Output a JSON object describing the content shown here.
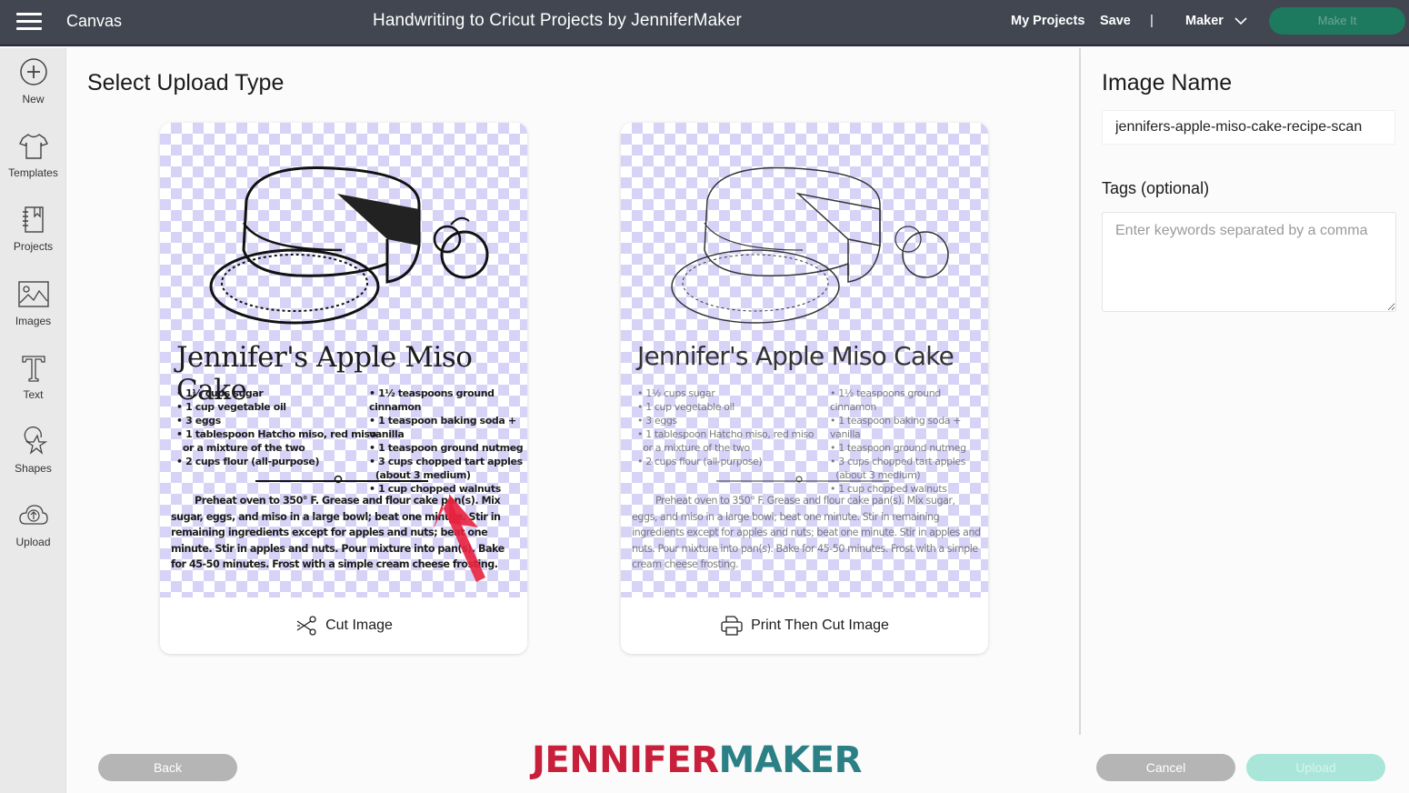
{
  "topbar": {
    "app_title": "Canvas",
    "document_title": "Handwriting to Cricut Projects by JenniferMaker",
    "my_projects": "My Projects",
    "save": "Save",
    "separator": "|",
    "machine": "Maker",
    "make_it": "Make It",
    "colors": {
      "background": "#414650",
      "make_it": "#1e7a5e"
    }
  },
  "sidebar": {
    "items": [
      {
        "label": "New",
        "icon": "plus-circle-icon"
      },
      {
        "label": "Templates",
        "icon": "tshirt-icon"
      },
      {
        "label": "Projects",
        "icon": "notebook-icon"
      },
      {
        "label": "Images",
        "icon": "image-icon"
      },
      {
        "label": "Text",
        "icon": "text-t-icon"
      },
      {
        "label": "Shapes",
        "icon": "shapes-icon"
      },
      {
        "label": "Upload",
        "icon": "cloud-upload-icon"
      }
    ]
  },
  "main": {
    "title": "Select Upload Type",
    "options": [
      {
        "label": "Cut Image",
        "icon": "scissors-icon"
      },
      {
        "label": "Print Then Cut Image",
        "icon": "printer-icon"
      }
    ],
    "recipe": {
      "title": "Jennifer's Apple Miso Cake",
      "ingredients_left": [
        "1½ cups sugar",
        "1 cup vegetable oil",
        "3 eggs",
        "1 tablespoon Hatcho miso, red miso",
        "or a mixture of the two",
        "2 cups flour (all-purpose)"
      ],
      "ingredients_right": [
        "1½ teaspoons ground cinnamon",
        "1 teaspoon baking soda + vanilla",
        "1 teaspoon ground nutmeg",
        "3 cups chopped tart apples",
        "(about 3 medium)",
        "1 cup chopped walnuts"
      ],
      "directions": "Preheat oven to 350° F. Grease and flour cake pan(s). Mix sugar, eggs, and miso in a large bowl; beat one minute. Stir in remaining ingredients except for apples and nuts; beat one minute. Stir in apples and nuts. Pour mixture into pan(s). Bake for 45-50 minutes. Frost with a simple cream cheese frosting."
    }
  },
  "right_panel": {
    "image_name_label": "Image Name",
    "image_name_value": "jennifers-apple-miso-cake-recipe-scan",
    "tags_label": "Tags (optional)",
    "tags_placeholder": "Enter keywords separated by a comma",
    "tags_value": ""
  },
  "footer": {
    "back": "Back",
    "cancel": "Cancel",
    "upload": "Upload",
    "logo_part1": "JENNIFER",
    "logo_part2": "MAKER",
    "colors": {
      "logo_red": "#c8203a",
      "logo_teal": "#2b8086",
      "upload": "#a9e6d9"
    }
  }
}
